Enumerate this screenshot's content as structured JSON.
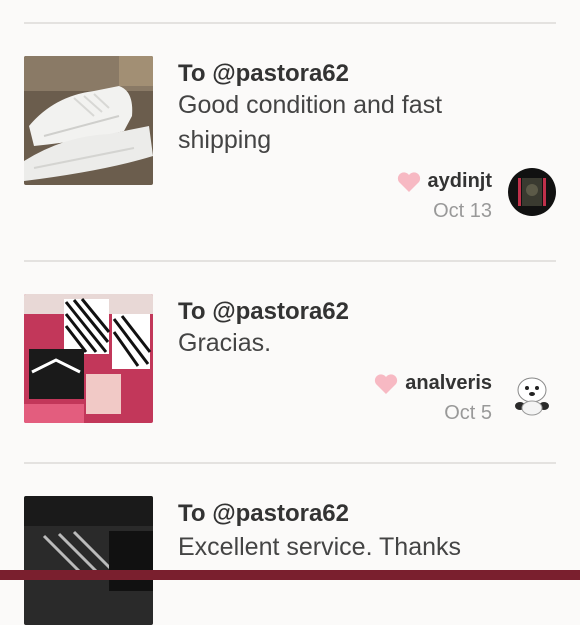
{
  "reviews": [
    {
      "to": "To @pastora62",
      "comment": "Good condition and fast shipping",
      "username": "aydinjt",
      "date": "Oct 13",
      "thumb_icon": "white-sneakers-photo",
      "avatar_icon": "dark-avatar"
    },
    {
      "to": "To @pastora62",
      "comment": "Gracias.",
      "username": "analveris",
      "date": "Oct 5",
      "thumb_icon": "striped-bags-photo",
      "avatar_icon": "cartoon-avatar"
    },
    {
      "to": "To @pastora62",
      "comment": "Excellent service. Thanks",
      "thumb_icon": "black-bag-photo"
    }
  ],
  "colors": {
    "heart": "#f7b9c3",
    "bottom_bar": "#7a1f2e"
  }
}
